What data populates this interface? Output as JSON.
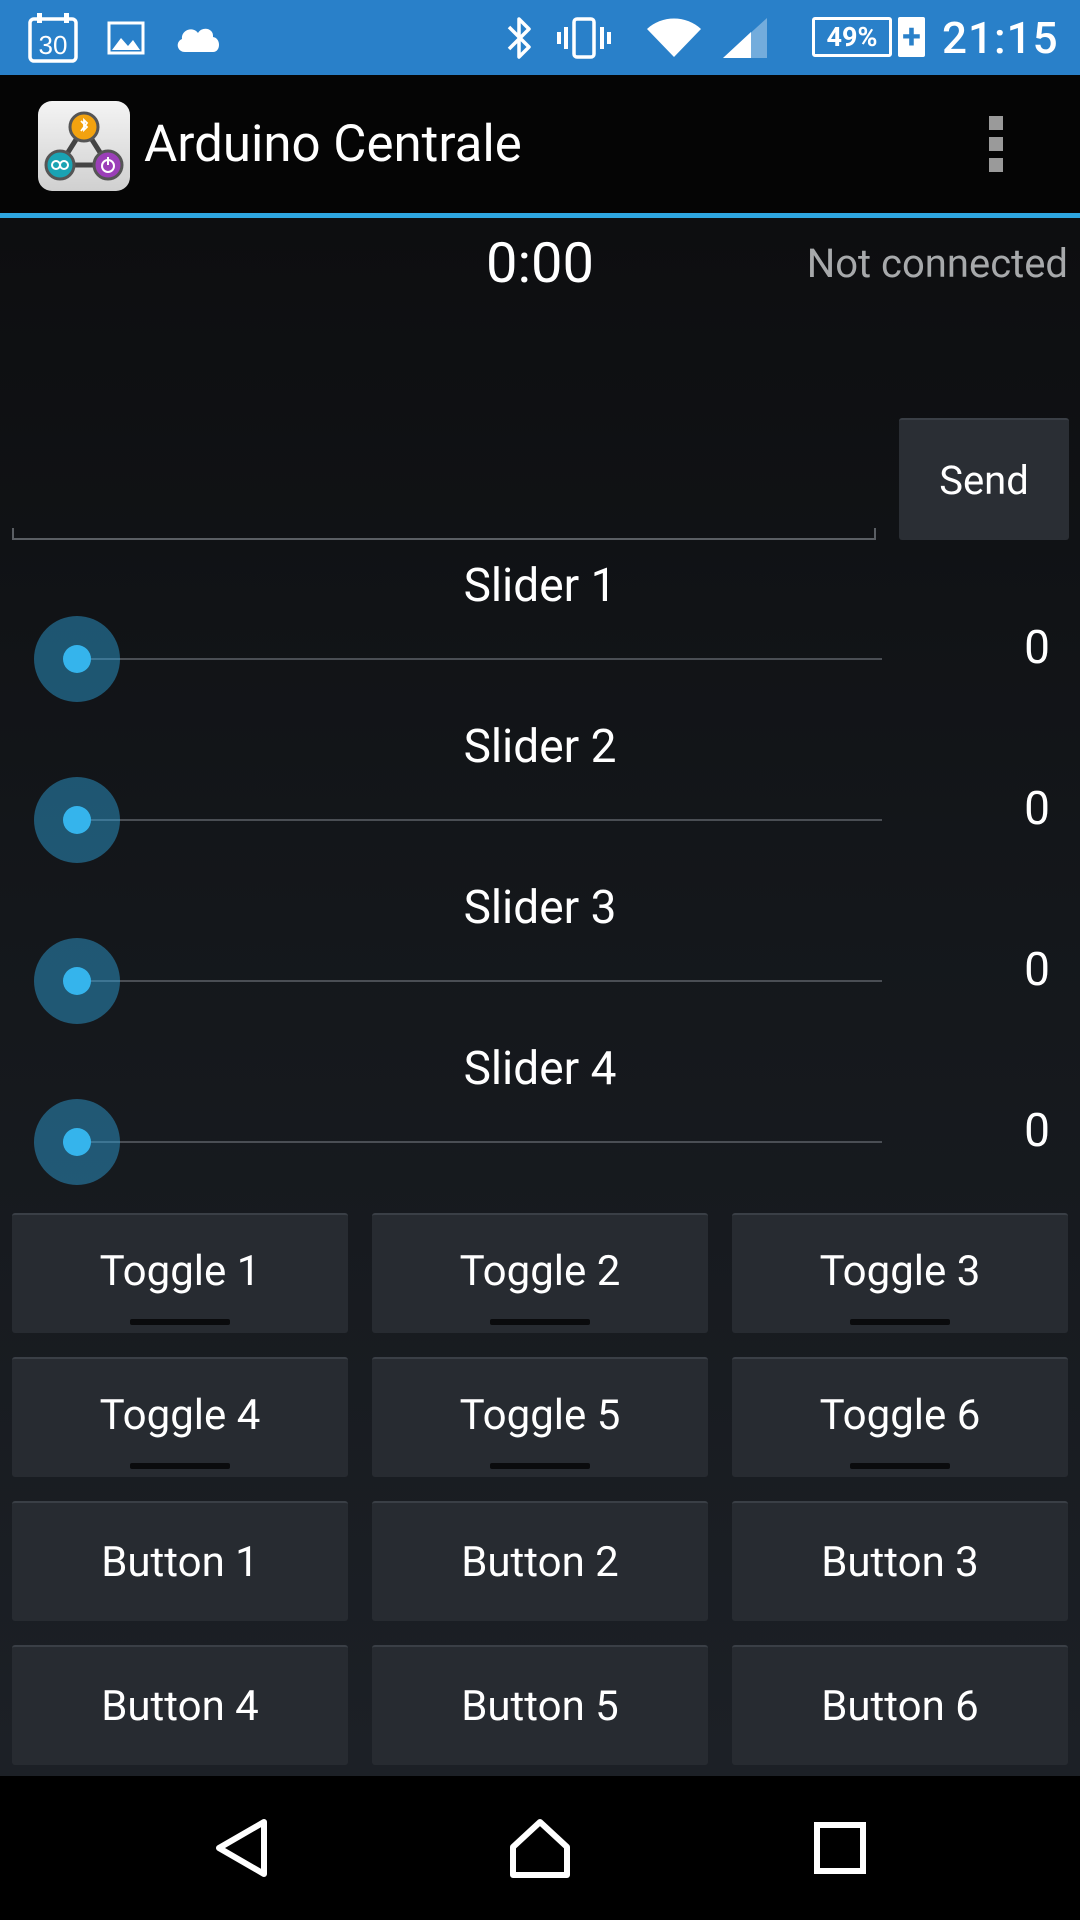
{
  "status_bar": {
    "calendar_day": "30",
    "battery_percent": "49%",
    "charging_symbol": "+",
    "time": "21:15",
    "icons": [
      "calendar-icon",
      "image-icon",
      "cloud-icon",
      "bluetooth-icon",
      "vibrate-icon",
      "wifi-icon",
      "cell-signal-icon",
      "battery-icon"
    ]
  },
  "action_bar": {
    "title": "Arduino Centrale",
    "overflow_icon": "overflow-menu-icon"
  },
  "header": {
    "timer": "0:00",
    "connection_status": "Not connected"
  },
  "message": {
    "input_value": "",
    "send_label": "Send"
  },
  "sliders": [
    {
      "label": "Slider 1",
      "value": "0",
      "level": 0
    },
    {
      "label": "Slider 2",
      "value": "0",
      "level": 0
    },
    {
      "label": "Slider 3",
      "value": "0",
      "level": 0
    },
    {
      "label": "Slider 4",
      "value": "0",
      "level": 0
    }
  ],
  "toggles": [
    {
      "label": "Toggle 1",
      "on": false
    },
    {
      "label": "Toggle 2",
      "on": false
    },
    {
      "label": "Toggle 3",
      "on": false
    },
    {
      "label": "Toggle 4",
      "on": false
    },
    {
      "label": "Toggle 5",
      "on": false
    },
    {
      "label": "Toggle 6",
      "on": false
    }
  ],
  "buttons": [
    {
      "label": "Button 1"
    },
    {
      "label": "Button 2"
    },
    {
      "label": "Button 3"
    },
    {
      "label": "Button 4"
    },
    {
      "label": "Button 5"
    },
    {
      "label": "Button 6"
    }
  ],
  "nav_bar": {
    "icons": [
      "back-icon",
      "home-icon",
      "recents-icon"
    ]
  },
  "colors": {
    "status_bar": "#2980c9",
    "accent": "#2ea6e0",
    "background": "#14171b",
    "button": "#272b31"
  }
}
